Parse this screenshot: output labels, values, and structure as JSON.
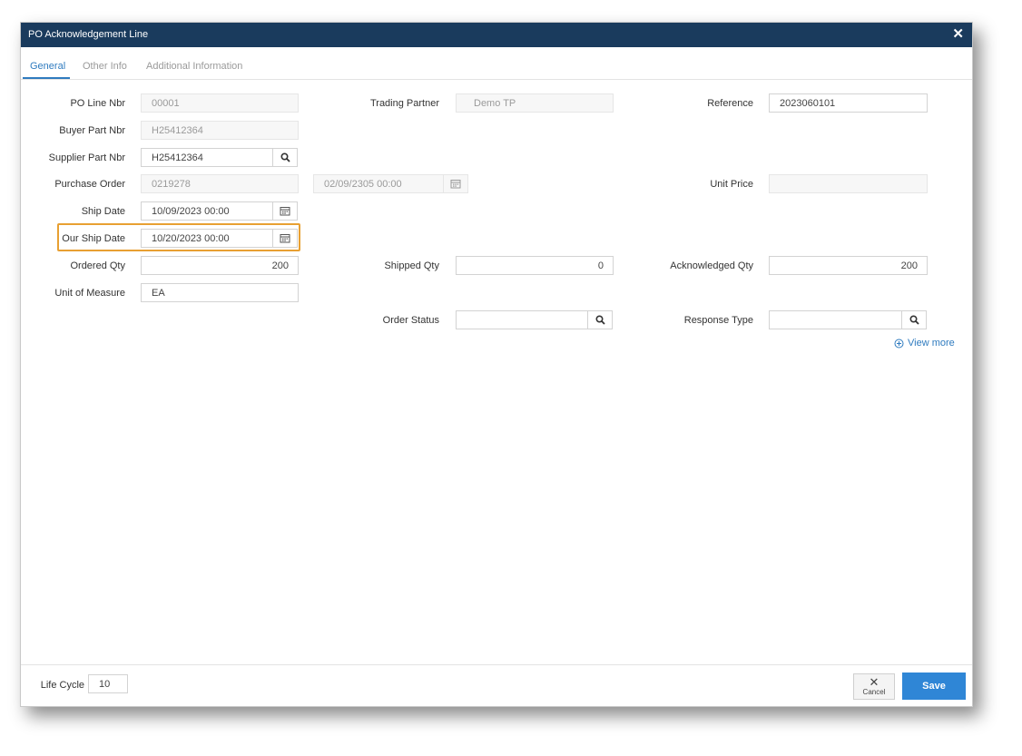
{
  "dialog": {
    "title": "PO Acknowledgement Line"
  },
  "tabs": [
    {
      "label": "General",
      "active": true
    },
    {
      "label": "Other Info",
      "active": false
    },
    {
      "label": "Additional Information",
      "active": false
    }
  ],
  "fields": {
    "po_line_nbr": {
      "label": "PO Line Nbr",
      "value": "00001"
    },
    "buyer_part_nbr": {
      "label": "Buyer Part Nbr",
      "value": "H25412364"
    },
    "supplier_part_nbr": {
      "label": "Supplier Part Nbr",
      "value": "H25412364"
    },
    "purchase_order": {
      "label": "Purchase Order",
      "value": "0219278",
      "date_value": "02/09/2305 00:00"
    },
    "ship_date": {
      "label": "Ship Date",
      "value": "10/09/2023 00:00"
    },
    "our_ship_date": {
      "label": "Our Ship Date",
      "value": "10/20/2023 00:00"
    },
    "ordered_qty": {
      "label": "Ordered Qty",
      "value": "200"
    },
    "unit_of_measure": {
      "label": "Unit of Measure",
      "value": "EA"
    },
    "trading_partner": {
      "label": "Trading Partner",
      "value": "Demo TP"
    },
    "shipped_qty": {
      "label": "Shipped Qty",
      "value": "0"
    },
    "order_status": {
      "label": "Order Status",
      "value": ""
    },
    "reference": {
      "label": "Reference",
      "value": "2023060101"
    },
    "unit_price": {
      "label": "Unit Price",
      "value": ""
    },
    "acknowledged_qty": {
      "label": "Acknowledged Qty",
      "value": "200"
    },
    "response_type": {
      "label": "Response Type",
      "value": ""
    }
  },
  "view_more": "View more",
  "footer": {
    "life_cycle_label": "Life Cycle",
    "life_cycle_value": "10",
    "cancel_label": "Cancel",
    "save_label": "Save"
  },
  "colors": {
    "titlebar": "#1a3b5d",
    "accent": "#2f7bbf",
    "save_button": "#2f86d6",
    "highlight": "#e8a032"
  }
}
